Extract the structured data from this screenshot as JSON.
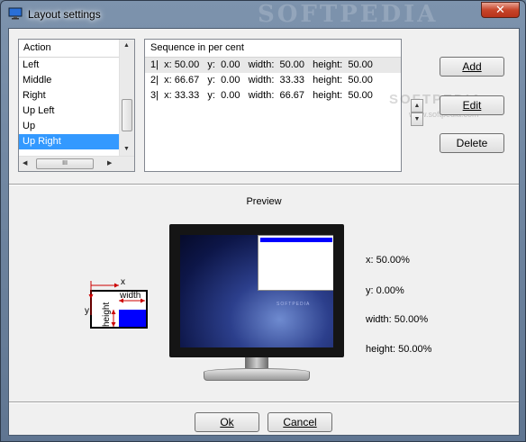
{
  "window": {
    "title": "Layout settings",
    "watermark": "SOFTPEDIA",
    "close_label": "✕"
  },
  "action_list": {
    "header": "Action",
    "items": [
      "Left",
      "Middle",
      "Right",
      "Up Left",
      "Up",
      "Up Right"
    ],
    "selected_index": 5,
    "hscroll_thumb": "III"
  },
  "sequence_list": {
    "header": "Sequence in per cent",
    "rows": [
      "1|  x: 50.00   y:  0.00   width:  50.00   height:  50.00",
      "2|  x: 66.67   y:  0.00   width:  33.33   height:  50.00",
      "3|  x: 33.33   y:  0.00   width:  66.67   height:  50.00"
    ]
  },
  "side_watermark": {
    "brand": "SOFTPEDIA",
    "url": "www.softpedia.com"
  },
  "buttons": {
    "add": "Add",
    "edit": "Edit",
    "delete": "Delete",
    "ok": "Ok",
    "cancel": "Cancel"
  },
  "preview": {
    "title": "Preview",
    "diagram": {
      "x_label": "x",
      "y_label": "y",
      "width_label": "width",
      "height_label": "height"
    },
    "screen_text": "SOFTPEDIA",
    "info": {
      "x": "x: 50.00%",
      "y": "y: 0.00%",
      "width": "width: 50.00%",
      "height": "height: 50.00%"
    }
  },
  "colors": {
    "selection": "#3399ff",
    "region_fill": "#0000ff",
    "arrow_red": "#cc0000"
  }
}
